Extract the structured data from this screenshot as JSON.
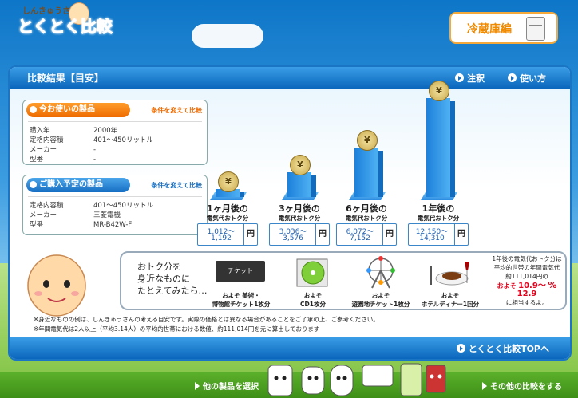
{
  "header": {
    "logo_top": "しんきゅうさん",
    "logo_main_a": "とくとく",
    "logo_main_b": "比較",
    "category_button": "冷蔵庫編"
  },
  "panel": {
    "title": "比較結果【目安】",
    "note_link": "注釈",
    "howto_link": "使い方",
    "top_link": "とくとく比較TOPへ"
  },
  "current": {
    "heading": "今お使いの製品",
    "change_link": "条件を変えて比較",
    "rows": [
      {
        "k": "購入年",
        "v": "2000年"
      },
      {
        "k": "定格内容積",
        "v": "401〜450リットル"
      },
      {
        "k": "メーカー",
        "v": "-"
      },
      {
        "k": "型番",
        "v": "-"
      }
    ]
  },
  "planned": {
    "heading": "ご購入予定の製品",
    "change_link": "条件を変えて比較",
    "rows": [
      {
        "k": "定格内容積",
        "v": "401〜450リットル"
      },
      {
        "k": "メーカー",
        "v": "三菱電機"
      },
      {
        "k": "型番",
        "v": "MR-B42W-F"
      }
    ]
  },
  "chart_data": {
    "type": "bar",
    "categories": [
      "1ヶ月後の",
      "3ヶ月後の",
      "6ヶ月後の",
      "1年後の"
    ],
    "subtitle": "電気代おトク分",
    "coin_symbol": "¥",
    "unit": "円",
    "ranges": [
      {
        "low": "1,012〜",
        "high": "1,192"
      },
      {
        "low": "3,036〜",
        "high": "3,576"
      },
      {
        "low": "6,072〜",
        "high": "7,152"
      },
      {
        "low": "12,150〜",
        "high": "14,310"
      }
    ],
    "values": [
      1192,
      3576,
      7152,
      14310
    ]
  },
  "compare": {
    "intro_1": "おトク分を",
    "intro_2": "身近なものに",
    "intro_3": "たとえてみたら…",
    "items": [
      {
        "label_1": "およそ 美術・",
        "label_2": "博物館チケット1枚分",
        "icon": "ticket-icon",
        "picture_text": "チケット"
      },
      {
        "label_1": "およそ",
        "label_2": "CD1枚分",
        "icon": "cd-icon"
      },
      {
        "label_1": "およそ",
        "label_2": "遊園地チケット1枚分",
        "icon": "ferris-wheel-icon"
      },
      {
        "label_1": "およそ",
        "label_2": "ホテルディナー1回分",
        "icon": "dinner-icon"
      }
    ],
    "side_1": "1年後の電気代おトク分は",
    "side_2": "平均的世帯の年間電気代",
    "side_3": "約111,014円の",
    "side_approx": "およそ",
    "side_pct_a": "10.9〜",
    "side_pct_b": "12.9",
    "side_pct_unit": "%",
    "side_4": "に相当するよ。"
  },
  "notes": [
    "※身近なものの例は、しんきゅうさんの考える目安です。実際の価格とは異なる場合があることをご了承の上、ご参考ください。",
    "※年間電気代は2人以上（平均3.14人）の平均的世帯における数値、約111,014円を元に算出しております"
  ],
  "bottom": {
    "left_link": "他の製品を選択",
    "right_link": "その他の比較をする"
  }
}
